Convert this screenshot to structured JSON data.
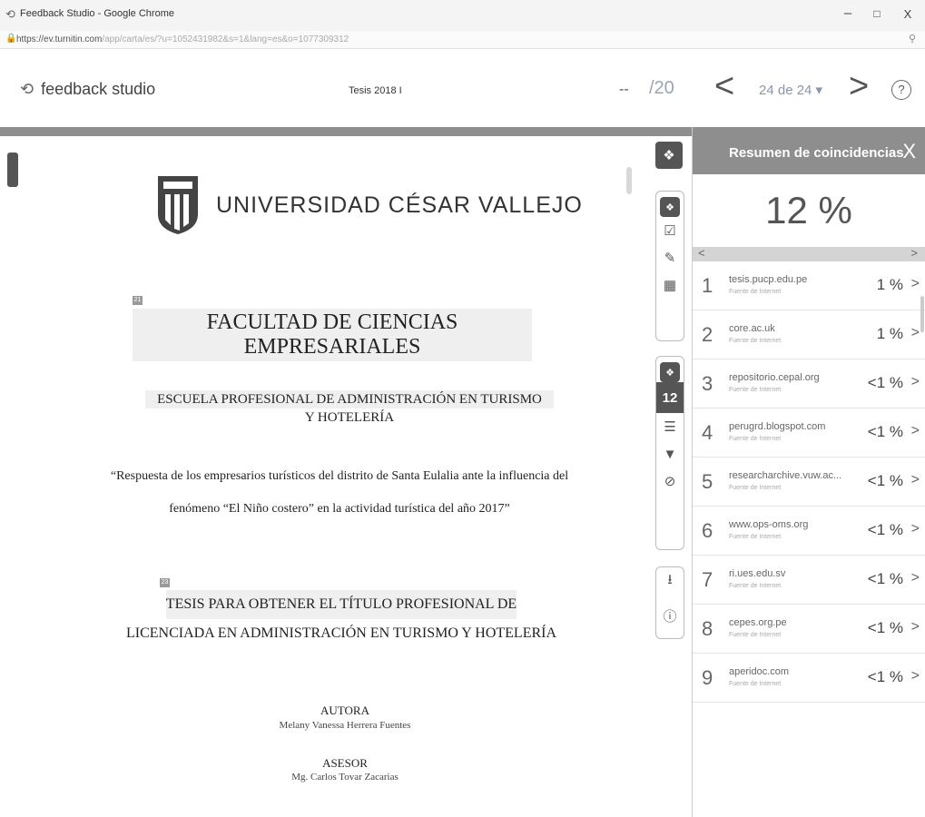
{
  "window": {
    "title": "Feedback Studio - Google Chrome",
    "url_main": "https://ev.turnitin.com",
    "url_rest": "/app/carta/es/?u=1052431982&s=1&lang=es&o=1077309312",
    "minimize": "–",
    "maximize": "□",
    "close": "X"
  },
  "header": {
    "brand": "feedback studio",
    "doc_title": "Tesis 2018 I",
    "grade_value": "--",
    "grade_max": "/20",
    "page_indicator": "24 de 24 ▾",
    "help": "?"
  },
  "document": {
    "university": "UNIVERSIDAD CÉSAR VALLEJO",
    "marker1": "21",
    "faculty": "FACULTAD DE CIENCIAS EMPRESARIALES",
    "school_line1": "ESCUELA PROFESIONAL DE ADMINISTRACIÓN EN TURISMO",
    "school_line2": "Y HOTELERÍA",
    "quote": "“Respuesta de los empresarios turísticos del distrito de Santa Eulalia ante la influencia del fenómeno “El Niño costero” en la actividad turística del año 2017”",
    "marker2": "23",
    "thesis_line1": "TESIS PARA OBTENER EL TÍTULO PROFESIONAL DE",
    "thesis_line2": "LICENCIADA EN ADMINISTRACIÓN EN TURISMO Y HOTELERÍA",
    "author_label": "AUTORA",
    "author_name": "Melany Vanessa Herrera Fuentes",
    "advisor_label": "ASESOR",
    "advisor_name": "Mg. Carlos Tovar Zacarias"
  },
  "toolbar": {
    "match_count": "12"
  },
  "panel": {
    "title": "Resumen de coincidencias",
    "close": "X",
    "overall": "12 %",
    "sources": [
      {
        "num": "1",
        "site": "tesis.pucp.edu.pe",
        "type": "Fuente de Internet",
        "pct": "1 %"
      },
      {
        "num": "2",
        "site": "core.ac.uk",
        "type": "Fuente de Internet",
        "pct": "1 %"
      },
      {
        "num": "3",
        "site": "repositorio.cepal.org",
        "type": "Fuente de Internet",
        "pct": "<1 %"
      },
      {
        "num": "4",
        "site": "perugrd.blogspot.com",
        "type": "Fuente de Internet",
        "pct": "<1 %"
      },
      {
        "num": "5",
        "site": "researcharchive.vuw.ac...",
        "type": "Fuente de Internet",
        "pct": "<1 %"
      },
      {
        "num": "6",
        "site": "www.ops-oms.org",
        "type": "Fuente de Internet",
        "pct": "<1 %"
      },
      {
        "num": "7",
        "site": "ri.ues.edu.sv",
        "type": "Fuente de Internet",
        "pct": "<1 %"
      },
      {
        "num": "8",
        "site": "cepes.org.pe",
        "type": "Fuente de Internet",
        "pct": "<1 %"
      },
      {
        "num": "9",
        "site": "aperidoc.com",
        "type": "Fuente de Internet",
        "pct": "<1 %"
      }
    ]
  }
}
